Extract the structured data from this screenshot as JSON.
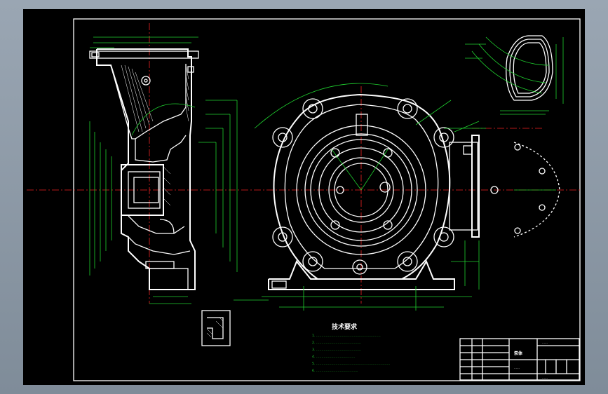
{
  "drawing": {
    "tech_requirements": {
      "title": "技术要求",
      "lines": [
        "1. ……………………………………………………",
        "2. ……………………………………",
        "3. ……………………………………",
        "4. ………………………………",
        "5. ……………………………………………………………",
        "6. …………………………………"
      ]
    },
    "title_block": {
      "part_name": "泵体",
      "drawing_no": "……",
      "material": "……",
      "company": "……"
    },
    "colors": {
      "sheet_bg": "#000000",
      "outline": "#ffffff",
      "dimension": "#1fd12f",
      "centerline": "#e22222",
      "window_bg": "#8d99a6"
    }
  }
}
